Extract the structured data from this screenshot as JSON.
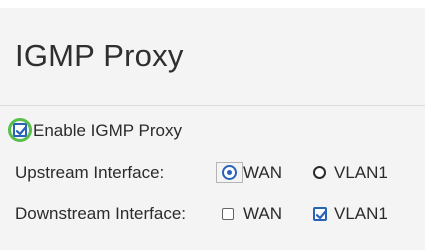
{
  "page": {
    "title": "IGMP Proxy"
  },
  "enable": {
    "label": "Enable IGMP Proxy",
    "checked": true
  },
  "upstream": {
    "label": "Upstream Interface:",
    "options": [
      {
        "label": "WAN",
        "selected": true
      },
      {
        "label": "VLAN1",
        "selected": false
      }
    ]
  },
  "downstream": {
    "label": "Downstream Interface:",
    "options": [
      {
        "label": "WAN",
        "checked": false
      },
      {
        "label": "VLAN1",
        "checked": true
      }
    ]
  },
  "colors": {
    "accent": "#2a62b8",
    "focus_ring": "#57c04a",
    "background": "#f4f4f4"
  }
}
